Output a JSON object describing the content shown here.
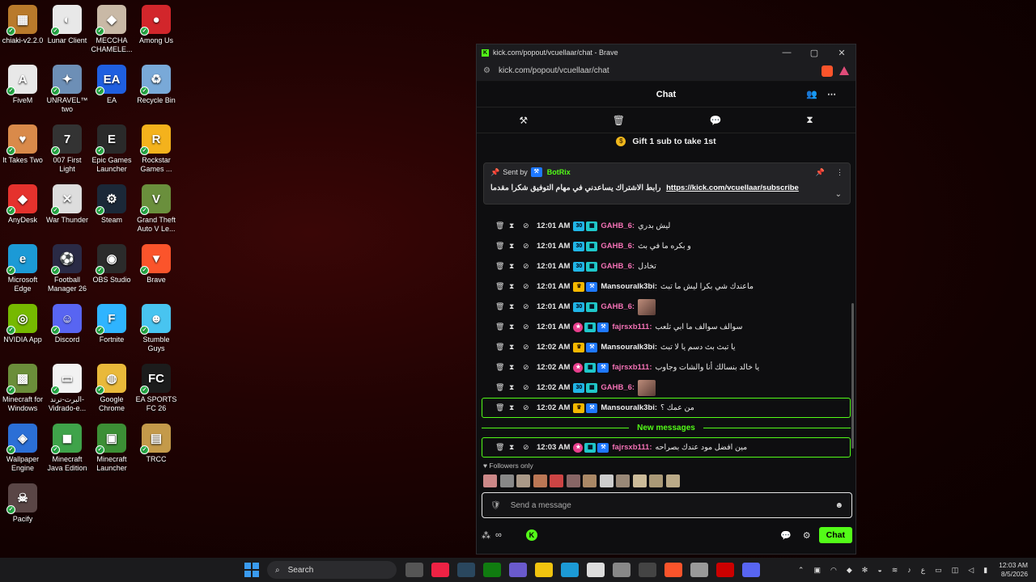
{
  "desktop_icons": [
    {
      "label": "chiaki-v2.2.0",
      "color": "#b97a2b",
      "glyph": "▦"
    },
    {
      "label": "Lunar Client",
      "color": "#e8e8e8",
      "glyph": "◐"
    },
    {
      "label": "MECCHA CHAMELE...",
      "color": "#c9b9a6",
      "glyph": "◆"
    },
    {
      "label": "Among Us",
      "color": "#d2262b",
      "glyph": "●"
    },
    {
      "label": "FiveM",
      "color": "#e8e8e8",
      "glyph": "A"
    },
    {
      "label": "UNRAVEL™ two",
      "color": "#6d8fb6",
      "glyph": "✦"
    },
    {
      "label": "EA",
      "color": "#1f5fe0",
      "glyph": "EA"
    },
    {
      "label": "Recycle Bin",
      "color": "#79a9d8",
      "glyph": "♻"
    },
    {
      "label": "It Takes Two",
      "color": "#d98a4a",
      "glyph": "♥"
    },
    {
      "label": "007 First Light",
      "color": "#333333",
      "glyph": "7"
    },
    {
      "label": "Epic Games Launcher",
      "color": "#2a2a2a",
      "glyph": "E"
    },
    {
      "label": "Rockstar Games ...",
      "color": "#f4b21c",
      "glyph": "R"
    },
    {
      "label": "AnyDesk",
      "color": "#e5322d",
      "glyph": "◆"
    },
    {
      "label": "War Thunder",
      "color": "#dddddd",
      "glyph": "✕"
    },
    {
      "label": "Steam",
      "color": "#1b2838",
      "glyph": "⚙"
    },
    {
      "label": "Grand Theft Auto V Le...",
      "color": "#6a8f3c",
      "glyph": "V"
    },
    {
      "label": "Microsoft Edge",
      "color": "#1c9ad6",
      "glyph": "e"
    },
    {
      "label": "Football Manager 26",
      "color": "#2a2a45",
      "glyph": "⚽"
    },
    {
      "label": "OBS Studio",
      "color": "#2b2b2b",
      "glyph": "◉"
    },
    {
      "label": "Brave",
      "color": "#fb542b",
      "glyph": "▼"
    },
    {
      "label": "NVIDIA App",
      "color": "#76b900",
      "glyph": "◎"
    },
    {
      "label": "Discord",
      "color": "#5865f2",
      "glyph": "☺"
    },
    {
      "label": "Fortnite",
      "color": "#2fb4ff",
      "glyph": "F"
    },
    {
      "label": "Stumble Guys",
      "color": "#48c4f0",
      "glyph": "☻"
    },
    {
      "label": "Minecraft for Windows",
      "color": "#6b8e3a",
      "glyph": "▩"
    },
    {
      "label": "البرت-ترند-Vidrado-e...",
      "color": "#f2f2f2",
      "glyph": "▭"
    },
    {
      "label": "Google Chrome",
      "color": "#e9b93a",
      "glyph": "◍"
    },
    {
      "label": "EA SPORTS FC 26",
      "color": "#1c1c1c",
      "glyph": "FC"
    },
    {
      "label": "Wallpaper Engine",
      "color": "#2b6fd6",
      "glyph": "◈"
    },
    {
      "label": "Minecraft Java Edition",
      "color": "#3fa34a",
      "glyph": "◼"
    },
    {
      "label": "Minecraft Launcher",
      "color": "#3c8f35",
      "glyph": "▣"
    },
    {
      "label": "TRCC",
      "color": "#c49a4a",
      "glyph": "▤"
    },
    {
      "label": "Pacify",
      "color": "#5a4646",
      "glyph": "☠"
    }
  ],
  "browser": {
    "window_title": "kick.com/popout/vcuellaar/chat - Brave",
    "url": "kick.com/popout/vcuellaar/chat",
    "minimize": "—",
    "maximize": "▢",
    "close": "✕"
  },
  "chat": {
    "header_title": "Chat",
    "gift_text": "Gift 1 sub to take 1st",
    "pinned": {
      "sent_by": "Sent by",
      "sender": "BotRix",
      "text": "رابط الاشتراك يساعدني في مهام التوفيق شكرا مقدما",
      "link": "https://kick.com/vcuellaar/subscribe"
    },
    "messages": [
      {
        "time": "12:01 AM",
        "user": "GAHB_6:",
        "text": "ليش بدري",
        "badges": [
          "sub",
          "sq"
        ],
        "color": "pink",
        "emote": false,
        "hl": false
      },
      {
        "time": "12:01 AM",
        "user": "GAHB_6:",
        "text": "و بكره ما في بث",
        "badges": [
          "sub",
          "sq"
        ],
        "color": "pink",
        "emote": false,
        "hl": false
      },
      {
        "time": "12:01 AM",
        "user": "GAHB_6:",
        "text": "تخادل",
        "badges": [
          "sub",
          "sq"
        ],
        "color": "pink",
        "emote": false,
        "hl": false
      },
      {
        "time": "12:01 AM",
        "user": "Mansouralk3bi:",
        "text": "ماعندك شي بكرا ليش ما تبث",
        "badges": [
          "vip",
          "mod"
        ],
        "color": "white",
        "emote": false,
        "hl": false
      },
      {
        "time": "12:01 AM",
        "user": "GAHB_6:",
        "text": "",
        "badges": [
          "sub",
          "sq"
        ],
        "color": "pink",
        "emote": true,
        "hl": false
      },
      {
        "time": "12:01 AM",
        "user": "fajrsxb111:",
        "text": "سوالف سوالف ما ابي تلعب",
        "badges": [
          "pink",
          "sq",
          "mod"
        ],
        "color": "pink",
        "emote": false,
        "hl": false
      },
      {
        "time": "12:02 AM",
        "user": "Mansouralk3bi:",
        "text": "يا تبث بث دسم يا لا تبث",
        "badges": [
          "vip",
          "mod"
        ],
        "color": "white",
        "emote": false,
        "hl": false
      },
      {
        "time": "12:02 AM",
        "user": "fajrsxb111:",
        "text": "يا خالد بنسالك أنا والشات وجاوب",
        "badges": [
          "pink",
          "sq",
          "mod"
        ],
        "color": "pink",
        "emote": false,
        "hl": false
      },
      {
        "time": "12:02 AM",
        "user": "GAHB_6:",
        "text": "",
        "badges": [
          "sub",
          "sq"
        ],
        "color": "pink",
        "emote": true,
        "hl": false
      },
      {
        "time": "12:02 AM",
        "user": "Mansouralk3bi:",
        "text": "من عمك ؟",
        "badges": [
          "vip",
          "mod"
        ],
        "color": "white",
        "emote": false,
        "hl": true
      }
    ],
    "new_messages_label": "New messages",
    "new_message": {
      "time": "12:03 AM",
      "user": "fajrsxb111:",
      "text": "مين افضل مود عندك بصراحه",
      "badges": [
        "pink",
        "sq",
        "mod"
      ],
      "color": "pink",
      "emote": false,
      "hl": true
    },
    "followers_only": "Followers only",
    "input_placeholder": "Send a message",
    "chat_button": "Chat"
  },
  "taskbar": {
    "search_label": "Search",
    "time": "12:03 AM",
    "date": "8/5/2026",
    "lang": "ع"
  }
}
